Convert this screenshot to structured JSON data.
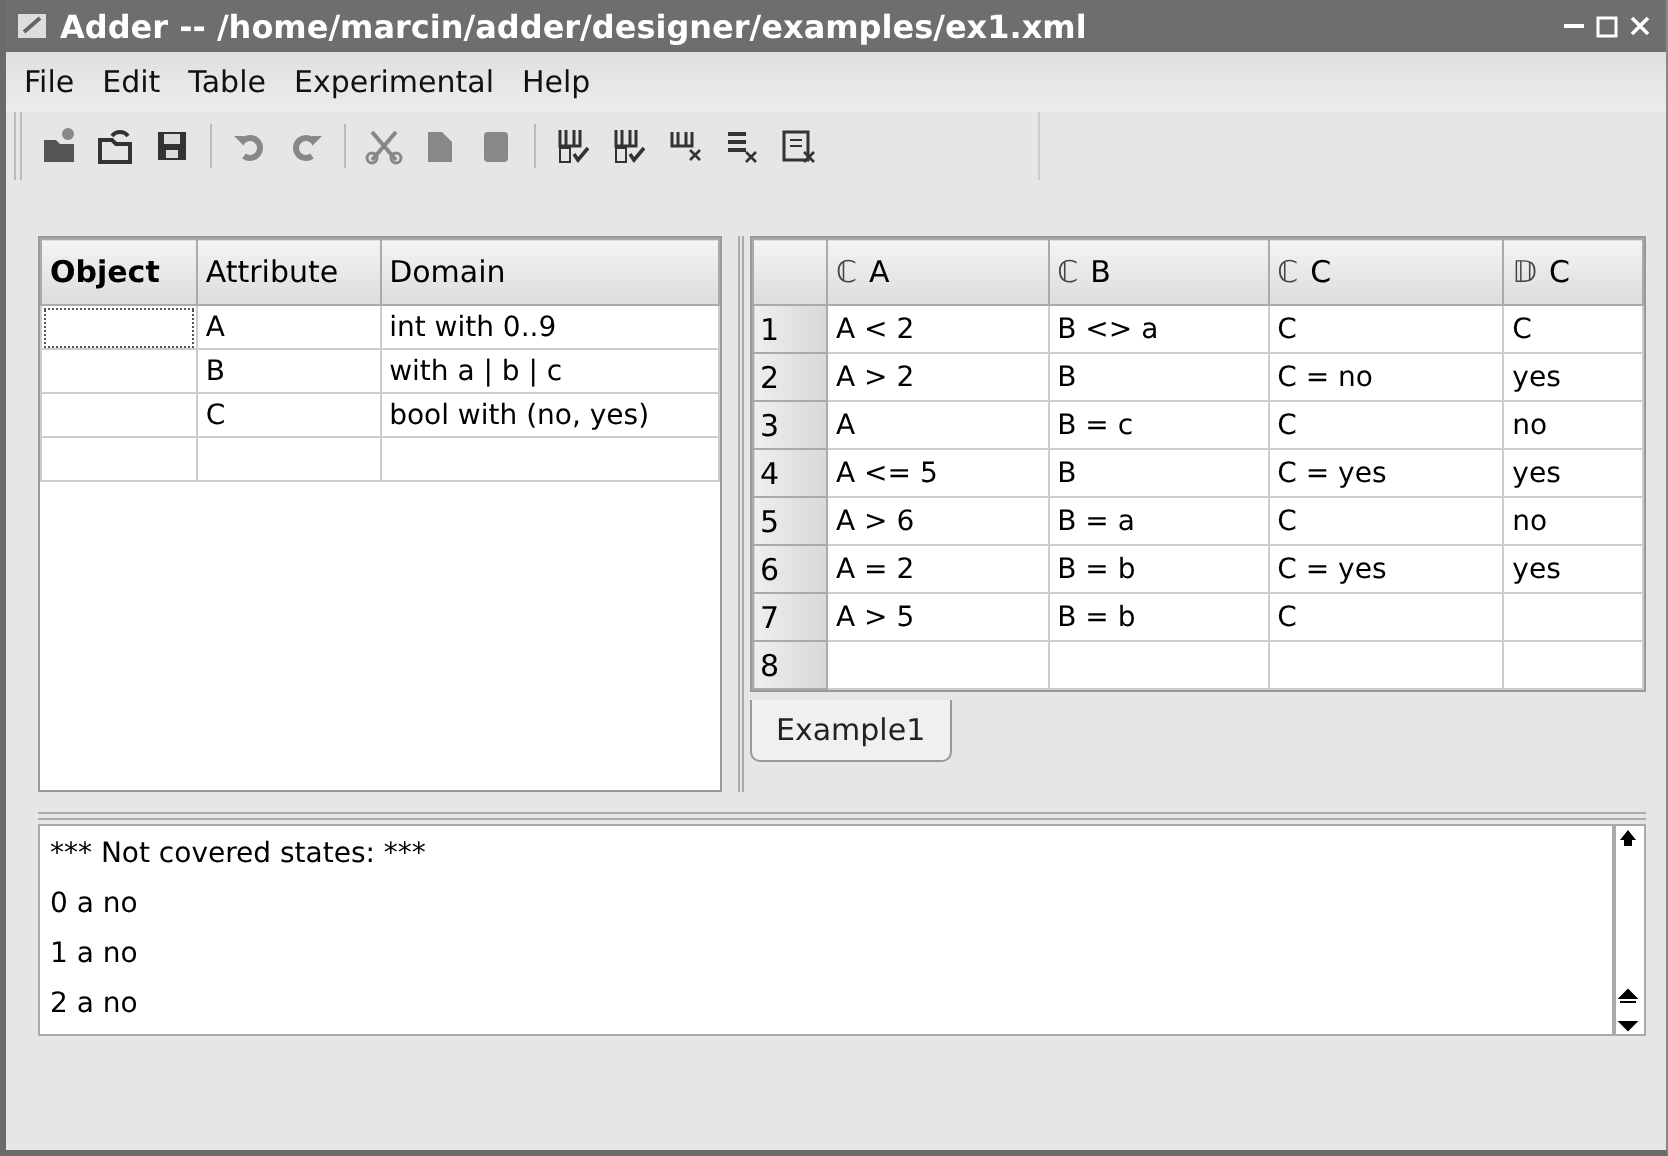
{
  "window": {
    "title": "Adder -- /home/marcin/adder/designer/examples/ex1.xml"
  },
  "menu": [
    "File",
    "Edit",
    "Table",
    "Experimental",
    "Help"
  ],
  "toolbar": [
    {
      "kind": "new"
    },
    {
      "kind": "open"
    },
    {
      "kind": "save"
    },
    {
      "kind": "sep"
    },
    {
      "kind": "undo"
    },
    {
      "kind": "redo"
    },
    {
      "kind": "sep"
    },
    {
      "kind": "cut"
    },
    {
      "kind": "copy"
    },
    {
      "kind": "paste"
    },
    {
      "kind": "sep"
    },
    {
      "kind": "addc"
    },
    {
      "kind": "addd"
    },
    {
      "kind": "delcol"
    },
    {
      "kind": "delrow"
    },
    {
      "kind": "deltable"
    }
  ],
  "objects_table": {
    "columns": [
      "Object",
      "Attribute",
      "Domain"
    ],
    "rows": [
      [
        "",
        "A",
        "int with 0..9"
      ],
      [
        "",
        "B",
        "with a | b | c"
      ],
      [
        "",
        "C",
        "bool with (no, yes)"
      ],
      [
        "",
        "",
        ""
      ]
    ]
  },
  "rules_table": {
    "columns": [
      {
        "mark": "ℂ",
        "label": "A"
      },
      {
        "mark": "ℂ",
        "label": "B"
      },
      {
        "mark": "ℂ",
        "label": "C"
      },
      {
        "mark": "𝔻",
        "label": "C"
      }
    ],
    "rows": [
      {
        "number": "1",
        "cells": [
          "A < 2",
          "B <> a",
          "C",
          "C"
        ]
      },
      {
        "number": "2",
        "cells": [
          "A > 2",
          "B",
          "C = no",
          "yes"
        ]
      },
      {
        "number": "3",
        "cells": [
          "A",
          "B = c",
          "C",
          "no"
        ]
      },
      {
        "number": "4",
        "cells": [
          "A <= 5",
          "B",
          "C = yes",
          "yes"
        ]
      },
      {
        "number": "5",
        "cells": [
          "A > 6",
          "B = a",
          "C",
          "no"
        ]
      },
      {
        "number": "6",
        "cells": [
          "A = 2",
          "B = b",
          "C = yes",
          "yes"
        ]
      },
      {
        "number": "7",
        "cells": [
          "A > 5",
          "B = b",
          "C",
          ""
        ]
      },
      {
        "number": "8",
        "cells": [
          "",
          "",
          "",
          ""
        ]
      }
    ]
  },
  "tabs": [
    {
      "label": "Example1",
      "selected": true
    }
  ],
  "log": [
    "*** Not covered states: ***",
    "0 a no",
    "1 a no",
    "2 a no"
  ]
}
